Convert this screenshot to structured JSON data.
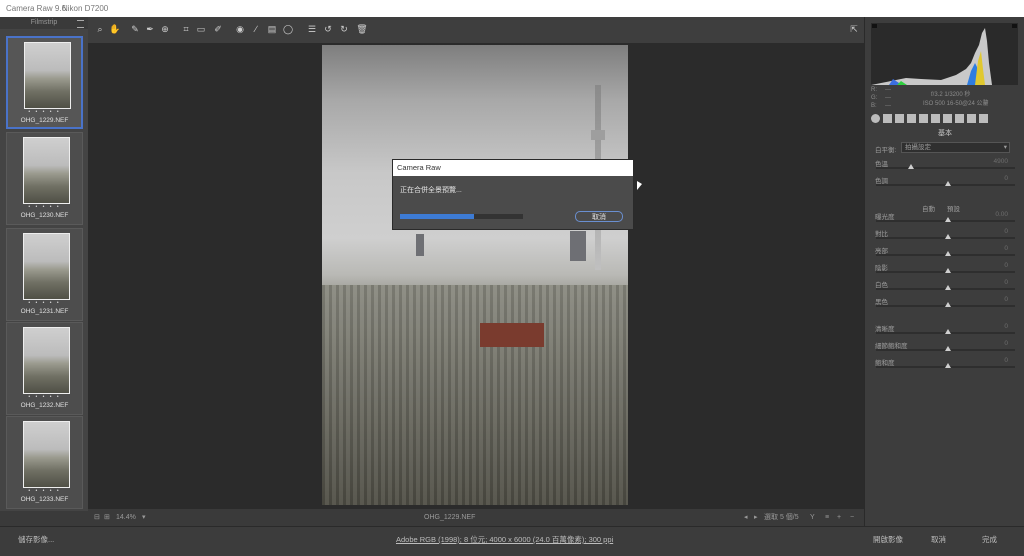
{
  "window": {
    "title": "Camera Raw 9.6",
    "camera": "Nikon D7200"
  },
  "filmstrip": {
    "label": "Filmstrip",
    "items": [
      {
        "name": "OHG_1229.NEF",
        "stars": "• • • • •"
      },
      {
        "name": "OHG_1230.NEF",
        "stars": "• • • • •"
      },
      {
        "name": "OHG_1231.NEF",
        "stars": "• • • • •"
      },
      {
        "name": "OHG_1232.NEF",
        "stars": "• • • • •"
      },
      {
        "name": "OHG_1233.NEF",
        "stars": "• • • • •"
      }
    ]
  },
  "toolbar": {
    "icons": [
      "zoom-icon",
      "hand-icon",
      "white-balance-icon",
      "color-sampler-icon",
      "target-adjust-icon",
      "crop-icon",
      "straighten-icon",
      "spot-removal-icon",
      "red-eye-icon",
      "adjustment-brush-icon",
      "graduated-filter-icon",
      "radial-filter-icon",
      "preferences-icon",
      "rotate-ccw-icon",
      "rotate-cw-icon",
      "trash-icon"
    ],
    "glyphs": [
      "⌕",
      "✋",
      "✎",
      "✒",
      "⊕",
      "⌗",
      "▭",
      "✐",
      "◉",
      "∕",
      "▤",
      "◯",
      "☰",
      "↺",
      "↻",
      "🗑"
    ]
  },
  "dialog": {
    "title": "Camera Raw",
    "message": "正在合併全景預覽...",
    "progress": 0.6,
    "cancel_label": "取消"
  },
  "status": {
    "zoom": "14.4%",
    "filename": "OHG_1229.NEF",
    "selection": "選取 5 個/5",
    "rating_buttons": [
      "Y",
      "≡",
      "+",
      "−"
    ]
  },
  "bottom": {
    "save_label": "儲存影像...",
    "workflow_link": "Adobe RGB (1998); 8 位元; 4000 x 6000 (24.0 百萬像素); 300 ppi",
    "open_label": "開啟影像",
    "cancel_label": "取消",
    "done_label": "完成"
  },
  "histogram": {
    "rgb_labels": [
      "R:",
      "G:",
      "B:"
    ],
    "rgb_values": [
      "---",
      "---",
      "---"
    ],
    "exif": [
      "f/3.2  1/3200 秒",
      "ISO 500   16-50@24 公釐"
    ]
  },
  "panel": {
    "section_title": "基本",
    "white_balance_label": "白平衡:",
    "white_balance_value": "拍攝設定",
    "auto_label": "自動",
    "default_label": "預設",
    "sliders": [
      {
        "label": "色溫",
        "value": "4900",
        "level": 0.23
      },
      {
        "label": "色調",
        "value": "0",
        "level": 0.5
      },
      {
        "label": "曝光度",
        "value": "0.00",
        "level": 0.5
      },
      {
        "label": "對比",
        "value": "0",
        "level": 0.5
      },
      {
        "label": "亮部",
        "value": "0",
        "level": 0.5
      },
      {
        "label": "陰影",
        "value": "0",
        "level": 0.5
      },
      {
        "label": "白色",
        "value": "0",
        "level": 0.5
      },
      {
        "label": "黑色",
        "value": "0",
        "level": 0.5
      },
      {
        "label": "清晰度",
        "value": "0",
        "level": 0.5
      },
      {
        "label": "細節飽和度",
        "value": "0",
        "level": 0.5
      },
      {
        "label": "飽和度",
        "value": "0",
        "level": 0.5
      }
    ],
    "tool_icons": [
      "basic-icon",
      "tone-curve-icon",
      "detail-icon",
      "hsl-icon",
      "split-toning-icon",
      "lens-icon",
      "effects-icon",
      "camera-calibration-icon",
      "presets-icon",
      "snapshots-icon"
    ]
  },
  "colors": {
    "accent": "#3d7bd4",
    "selection": "#4a73c9"
  }
}
